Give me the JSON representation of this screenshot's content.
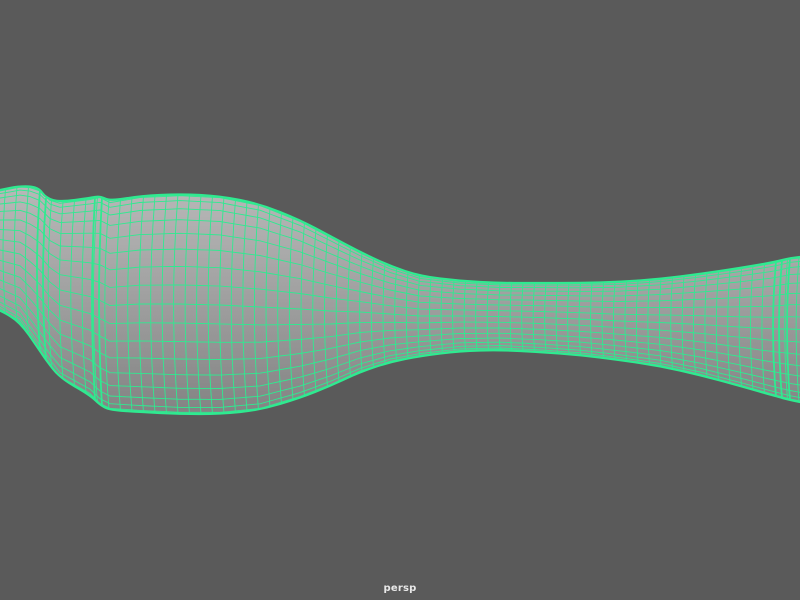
{
  "viewport": {
    "camera_name": "persp",
    "background_color": "#5a5a5a",
    "selected_object": {
      "shape": "lathe-turned-profile",
      "surface_color": "#a4a4a4",
      "wireframe_color": "#2fea90",
      "selection_state": "selected"
    }
  }
}
